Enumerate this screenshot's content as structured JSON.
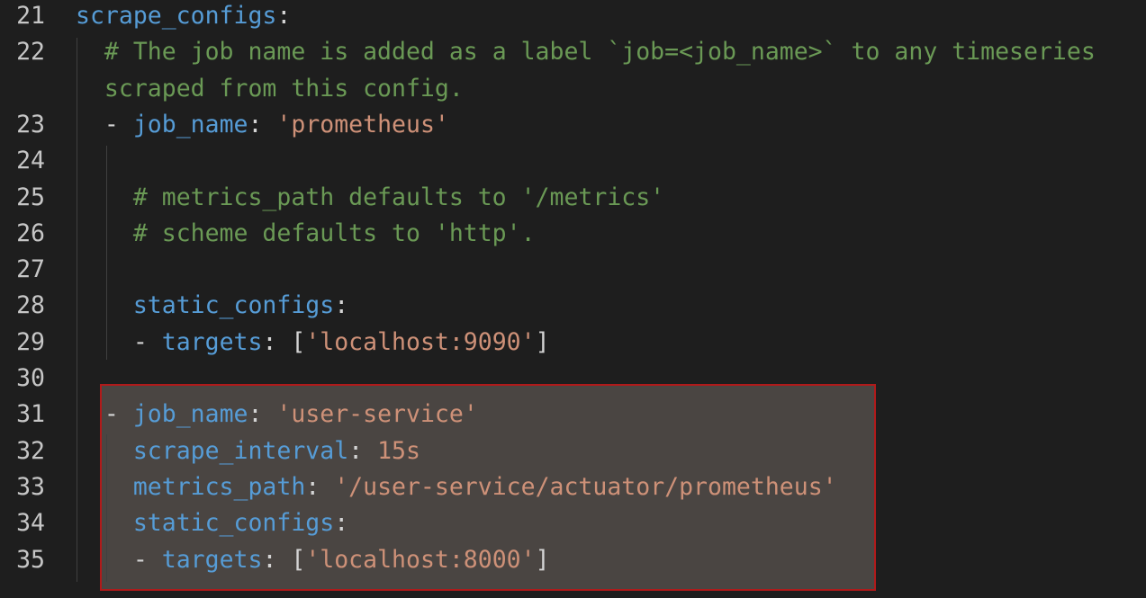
{
  "colors": {
    "background": "#1e1e1e",
    "key": "#569cd6",
    "string": "#ce9178",
    "number": "#b5cea8",
    "comment": "#6a9955",
    "highlight_border": "#b01a1a",
    "highlight_fill": "#4a4542"
  },
  "lines": [
    {
      "n": "21",
      "indent": "",
      "tokens": [
        {
          "t": "scrape_configs",
          "c": "key"
        },
        {
          "t": ":",
          "c": "punc"
        }
      ]
    },
    {
      "n": "22",
      "indent": "  ",
      "tokens": [
        {
          "t": "# The job name is added as a label `job=<job_name>` to any timeseries",
          "c": "cmt"
        }
      ]
    },
    {
      "n": "",
      "indent": "  ",
      "tokens": [
        {
          "t": "scraped from this config.",
          "c": "cmt"
        }
      ]
    },
    {
      "n": "23",
      "indent": "  ",
      "tokens": [
        {
          "t": "- ",
          "c": "punc"
        },
        {
          "t": "job_name",
          "c": "key"
        },
        {
          "t": ": ",
          "c": "punc"
        },
        {
          "t": "'prometheus'",
          "c": "str"
        }
      ]
    },
    {
      "n": "24",
      "indent": "",
      "tokens": []
    },
    {
      "n": "25",
      "indent": "    ",
      "tokens": [
        {
          "t": "# metrics_path defaults to '/metrics'",
          "c": "cmt"
        }
      ]
    },
    {
      "n": "26",
      "indent": "    ",
      "tokens": [
        {
          "t": "# scheme defaults to 'http'.",
          "c": "cmt"
        }
      ]
    },
    {
      "n": "27",
      "indent": "",
      "tokens": []
    },
    {
      "n": "28",
      "indent": "    ",
      "tokens": [
        {
          "t": "static_configs",
          "c": "key"
        },
        {
          "t": ":",
          "c": "punc"
        }
      ]
    },
    {
      "n": "29",
      "indent": "    ",
      "tokens": [
        {
          "t": "- ",
          "c": "punc"
        },
        {
          "t": "targets",
          "c": "key"
        },
        {
          "t": ": [",
          "c": "punc"
        },
        {
          "t": "'localhost:9090'",
          "c": "str"
        },
        {
          "t": "]",
          "c": "punc"
        }
      ]
    },
    {
      "n": "30",
      "indent": "",
      "tokens": []
    },
    {
      "n": "31",
      "indent": "  ",
      "tokens": [
        {
          "t": "- ",
          "c": "punc"
        },
        {
          "t": "job_name",
          "c": "key"
        },
        {
          "t": ": ",
          "c": "punc"
        },
        {
          "t": "'user-service'",
          "c": "str"
        }
      ]
    },
    {
      "n": "32",
      "indent": "    ",
      "tokens": [
        {
          "t": "scrape_interval",
          "c": "key"
        },
        {
          "t": ": ",
          "c": "punc"
        },
        {
          "t": "15s",
          "c": "str"
        }
      ]
    },
    {
      "n": "33",
      "indent": "    ",
      "tokens": [
        {
          "t": "metrics_path",
          "c": "key"
        },
        {
          "t": ": ",
          "c": "punc"
        },
        {
          "t": "'/user-service/actuator/prometheus'",
          "c": "str"
        }
      ]
    },
    {
      "n": "34",
      "indent": "    ",
      "tokens": [
        {
          "t": "static_configs",
          "c": "key"
        },
        {
          "t": ":",
          "c": "punc"
        }
      ]
    },
    {
      "n": "35",
      "indent": "    ",
      "tokens": [
        {
          "t": "- ",
          "c": "punc"
        },
        {
          "t": "targets",
          "c": "key"
        },
        {
          "t": ": [",
          "c": "punc"
        },
        {
          "t": "'localhost:8000'",
          "c": "str"
        },
        {
          "t": "]",
          "c": "punc"
        }
      ]
    }
  ]
}
